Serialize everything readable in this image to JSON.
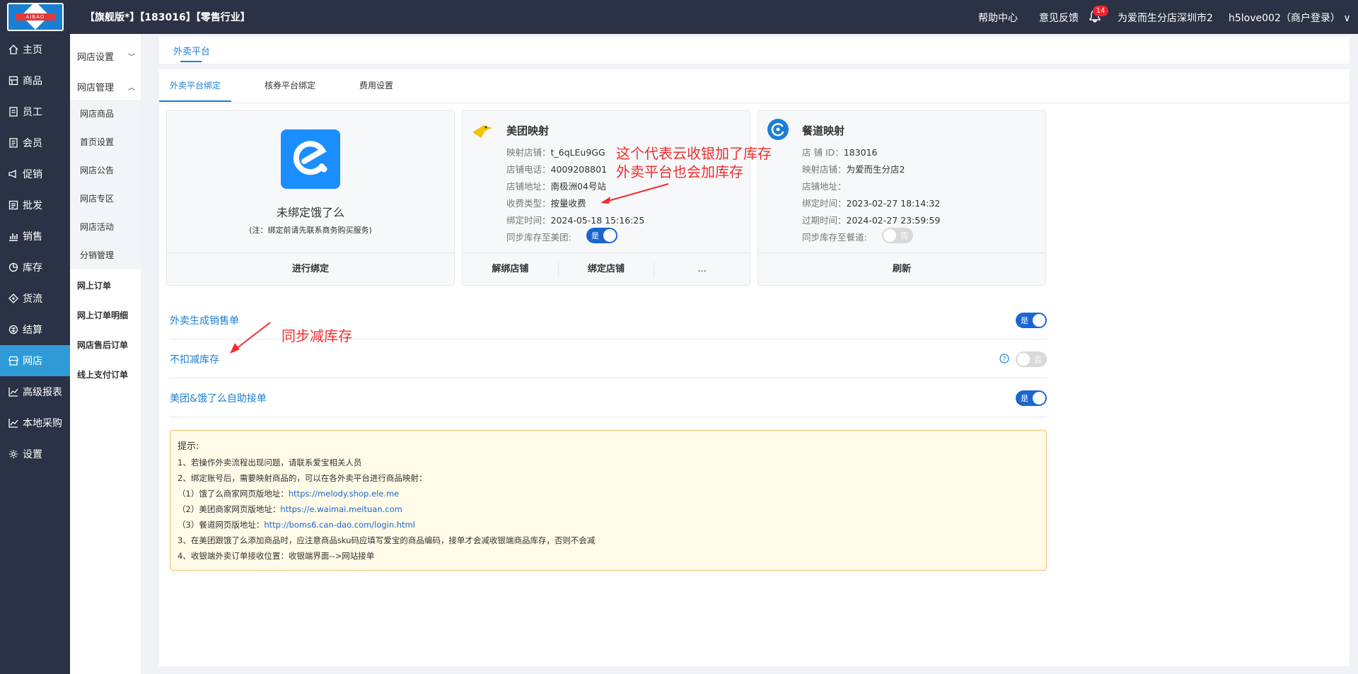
{
  "header": {
    "store_title": "【旗舰版*】【183016】【零售行业】",
    "logo_text": "AIBAO",
    "help": "帮助中心",
    "feedback": "意见反馈",
    "notifications": "14",
    "store_name": "为爱而生分店深圳市2",
    "user": "h5love002（商户登录）"
  },
  "sidebar": {
    "items": [
      {
        "label": "主页",
        "icon": "home-icon"
      },
      {
        "label": "商品",
        "icon": "goods-icon"
      },
      {
        "label": "员工",
        "icon": "staff-icon"
      },
      {
        "label": "会员",
        "icon": "member-icon"
      },
      {
        "label": "促销",
        "icon": "promo-icon"
      },
      {
        "label": "批发",
        "icon": "wholesale-icon"
      },
      {
        "label": "销售",
        "icon": "sales-icon"
      },
      {
        "label": "库存",
        "icon": "stock-icon"
      },
      {
        "label": "货流",
        "icon": "flow-icon"
      },
      {
        "label": "结算",
        "icon": "settle-icon"
      },
      {
        "label": "网店",
        "icon": "shop-icon"
      },
      {
        "label": "高级报表",
        "icon": "report-icon"
      },
      {
        "label": "本地采购",
        "icon": "purchase-icon"
      },
      {
        "label": "设置",
        "icon": "gear-icon"
      }
    ]
  },
  "subnav": {
    "group1": "网店设置",
    "group2": "网店管理",
    "children": [
      "网店商品",
      "首页设置",
      "网店公告",
      "网店专区",
      "网店活动",
      "分销管理"
    ],
    "links": [
      "网上订单",
      "网上订单明细",
      "网店售后订单",
      "线上支付订单"
    ]
  },
  "main": {
    "top_tab": "外卖平台",
    "tabs": [
      "外卖平台绑定",
      "核券平台绑定",
      "费用设置"
    ]
  },
  "cards": {
    "eleme": {
      "status": "未绑定饿了么",
      "note": "(注：绑定前请先联系商务购买服务)",
      "action": "进行绑定"
    },
    "meituan": {
      "title": "美团映射",
      "rows": [
        {
          "k": "映射店铺：",
          "v": "t_6qLEu9GG"
        },
        {
          "k": "店铺电话：",
          "v": "4009208801"
        },
        {
          "k": "店铺地址：",
          "v": "南极洲04号站"
        },
        {
          "k": "收费类型：",
          "v": "按量收费"
        },
        {
          "k": "绑定时间：",
          "v": "2024-05-18 15:16:25"
        }
      ],
      "sync_label": "同步库存至美团:",
      "sync_state": "是",
      "actions": [
        "解绑店铺",
        "绑定店铺",
        "..."
      ]
    },
    "caidao": {
      "title": "餐道映射",
      "rows": [
        {
          "k": "店 铺 ID：",
          "v": "183016"
        },
        {
          "k": "映射店铺：",
          "v": "为爱而生分店2"
        },
        {
          "k": "店铺地址：",
          "v": ""
        },
        {
          "k": "绑定时间：",
          "v": "2023-02-27 18:14:32"
        },
        {
          "k": "过期时间：",
          "v": "2024-02-27 23:59:59"
        }
      ],
      "sync_label": "同步库存至餐道:",
      "sync_state": "否",
      "action": "刷新"
    }
  },
  "settings": [
    {
      "label": "外卖生成销售单",
      "state": "是"
    },
    {
      "label": "不扣减库存",
      "state": "否"
    },
    {
      "label": "美团&饿了么自助接单",
      "state": "是"
    }
  ],
  "tips": {
    "title": "提示:",
    "l1": "1、若操作外卖流程出现问题，请联系爱宝相关人员",
    "l2": "2、绑定账号后，需要映射商品的，可以在各外卖平台进行商品映射：",
    "l3_pre": "（1）饿了么商家网页版地址：",
    "l3_url": "https://melody.shop.ele.me",
    "l4_pre": "（2）美团商家网页版地址：",
    "l4_url": "https://e.waimai.meituan.com",
    "l5_pre": "（3）餐道网页版地址：",
    "l5_url": "http://boms6.can-dao.com/login.html",
    "l6": "3、在美团跟饿了么添加商品时，应注意商品sku码应填写爱宝的商品编码，接单才会减收银端商品库存，否则不会减",
    "l7": "4、收银端外卖订单接收位置：收银端界面-->网站接单"
  },
  "annotations": {
    "a1_line1": "这个代表云收银加了库存",
    "a1_line2": "外卖平台也会加库存",
    "a2": "同步减库存"
  },
  "colors": {
    "accent": "#1a7fd4",
    "sidebar": "#2b3245",
    "annotation": "#f02d2d"
  }
}
